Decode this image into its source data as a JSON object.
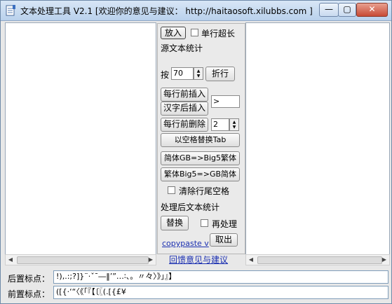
{
  "window": {
    "title": "文本处理工具 V2.1 [欢迎你的意见与建议： http://haitaosoft.xilubbs.com ]",
    "controls": {
      "minimize": "—",
      "maximize": "▢",
      "close": "✕"
    }
  },
  "colors": {
    "title_bar": "#c6daf1",
    "close_button": "#c74a35",
    "link": "#1a2fb0"
  },
  "left_pane": {
    "text": ""
  },
  "right_pane": {
    "text": ""
  },
  "controls": {
    "put_in": "放入",
    "single_line_too_long": "单行超长",
    "source_stats": "源文本统计",
    "by": "按",
    "wrap_width": "70",
    "fold": "折行",
    "insert_line_start": "每行前插入",
    "insert_after_han": "汉字后插入",
    "insert_value": ">",
    "delete_line_start": "每行前删除",
    "delete_count": "2",
    "space_to_tab": "以空格替换Tab",
    "gb_to_big5": "简体GB=>Big5繁体",
    "big5_to_gb": "繁体Big5=>GB简体",
    "trim_trailing": "清除行尾空格",
    "processed_stats": "处理后文本统计",
    "replace": "替换",
    "reprocess": "再处理",
    "copypaste_link": "copypaste v",
    "cancel": "取出",
    "feedback_link": "回馈意见与建议"
  },
  "bottom": {
    "trailing_label": "后置标点：",
    "trailing_value": "!),.:;?]}¨·ˇˉ―‖’”…∶、。〃々〉》」』】",
    "leading_label": "前置标点：",
    "leading_value": "([{·‘“〈《「『【〔〖(.[{£¥"
  }
}
